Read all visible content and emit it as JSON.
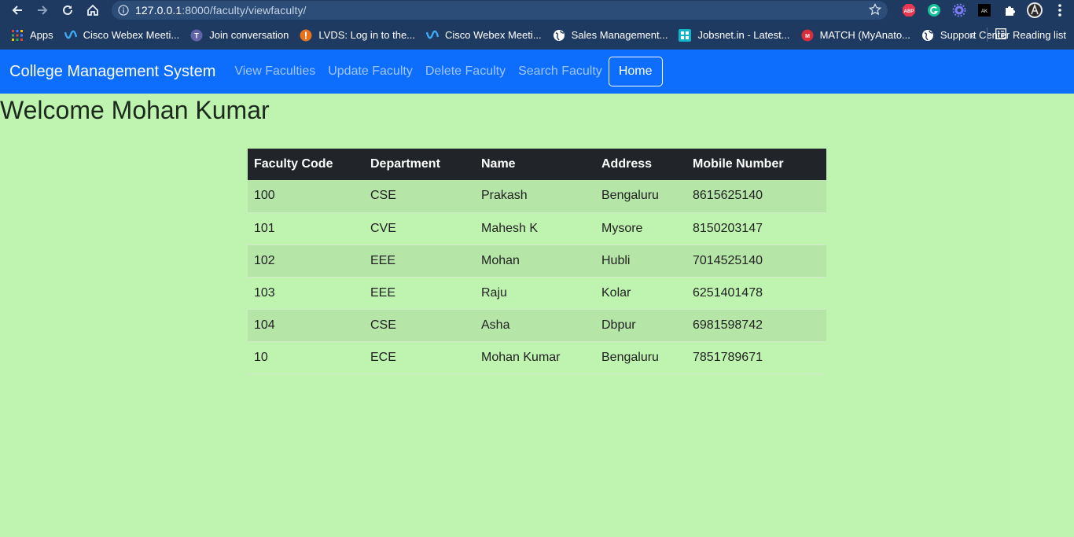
{
  "browser": {
    "url_host": "127.0.0.1",
    "url_rest": ":8000/faculty/viewfaculty/",
    "bookmarks": [
      {
        "label": "Apps",
        "icon": "apps-grid-icon"
      },
      {
        "label": "Cisco Webex Meeti...",
        "icon": "webex-icon"
      },
      {
        "label": "Join conversation",
        "icon": "teams-icon"
      },
      {
        "label": "LVDS: Log in to the...",
        "icon": "lvds-icon"
      },
      {
        "label": "Cisco Webex Meeti...",
        "icon": "webex-icon"
      },
      {
        "label": "Sales Management...",
        "icon": "globe-icon"
      },
      {
        "label": "Jobsnet.in - Latest...",
        "icon": "jobsnet-icon"
      },
      {
        "label": "MATCH (MyAnato...",
        "icon": "match-icon"
      },
      {
        "label": "Support Center",
        "icon": "globe-icon"
      }
    ],
    "more_label": "»",
    "reading_list": "Reading list",
    "ext_abp": "ABP",
    "ext_ak": "AK"
  },
  "navbar": {
    "brand": "College Management System",
    "links": [
      "View Faculties",
      "Update Faculty",
      "Delete Faculty",
      "Search Faculty"
    ],
    "home": "Home"
  },
  "welcome": "Welcome Mohan Kumar",
  "table": {
    "headers": [
      "Faculty Code",
      "Department",
      "Name",
      "Address",
      "Mobile Number"
    ],
    "rows": [
      [
        "100",
        "CSE",
        "Prakash",
        "Bengaluru",
        "8615625140"
      ],
      [
        "101",
        "CVE",
        "Mahesh K",
        "Mysore",
        "8150203147"
      ],
      [
        "102",
        "EEE",
        "Mohan",
        "Hubli",
        "7014525140"
      ],
      [
        "103",
        "EEE",
        "Raju",
        "Kolar",
        "6251401478"
      ],
      [
        "104",
        "CSE",
        "Asha",
        "Dbpur",
        "6981598742"
      ],
      [
        "10",
        "ECE",
        "Mohan Kumar",
        "Bengaluru",
        "7851789671"
      ]
    ]
  },
  "colors": {
    "navbar": "#0d6efd",
    "page_bg": "#bef4b0",
    "table_header": "#212529",
    "chrome": "#1f3a60"
  }
}
